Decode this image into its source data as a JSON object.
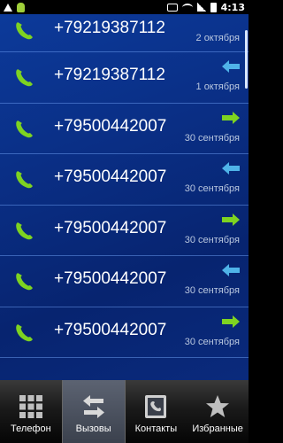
{
  "status_bar": {
    "time": "4:13"
  },
  "calls": [
    {
      "number": "+79219387112",
      "date": "2 октября",
      "direction": "none"
    },
    {
      "number": "+79219387112",
      "date": "1 октября",
      "direction": "incoming"
    },
    {
      "number": "+79500442007",
      "date": "30 сентября",
      "direction": "outgoing"
    },
    {
      "number": "+79500442007",
      "date": "30 сентября",
      "direction": "incoming"
    },
    {
      "number": "+79500442007",
      "date": "30 сентября",
      "direction": "outgoing"
    },
    {
      "number": "+79500442007",
      "date": "30 сентября",
      "direction": "incoming"
    },
    {
      "number": "+79500442007",
      "date": "30 сентября",
      "direction": "outgoing"
    }
  ],
  "tabs": [
    {
      "label": "Телефон",
      "icon": "dialpad-icon",
      "active": false
    },
    {
      "label": "Вызовы",
      "icon": "swap-arrows-icon",
      "active": true
    },
    {
      "label": "Контакты",
      "icon": "contacts-book-icon",
      "active": false
    },
    {
      "label": "Избранные",
      "icon": "star-icon",
      "active": false
    }
  ],
  "colors": {
    "phone_green": "#7ed321",
    "incoming_arrow": "#4fb3e8",
    "outgoing_arrow": "#7ed321",
    "list_bg": "#0a2f86"
  }
}
